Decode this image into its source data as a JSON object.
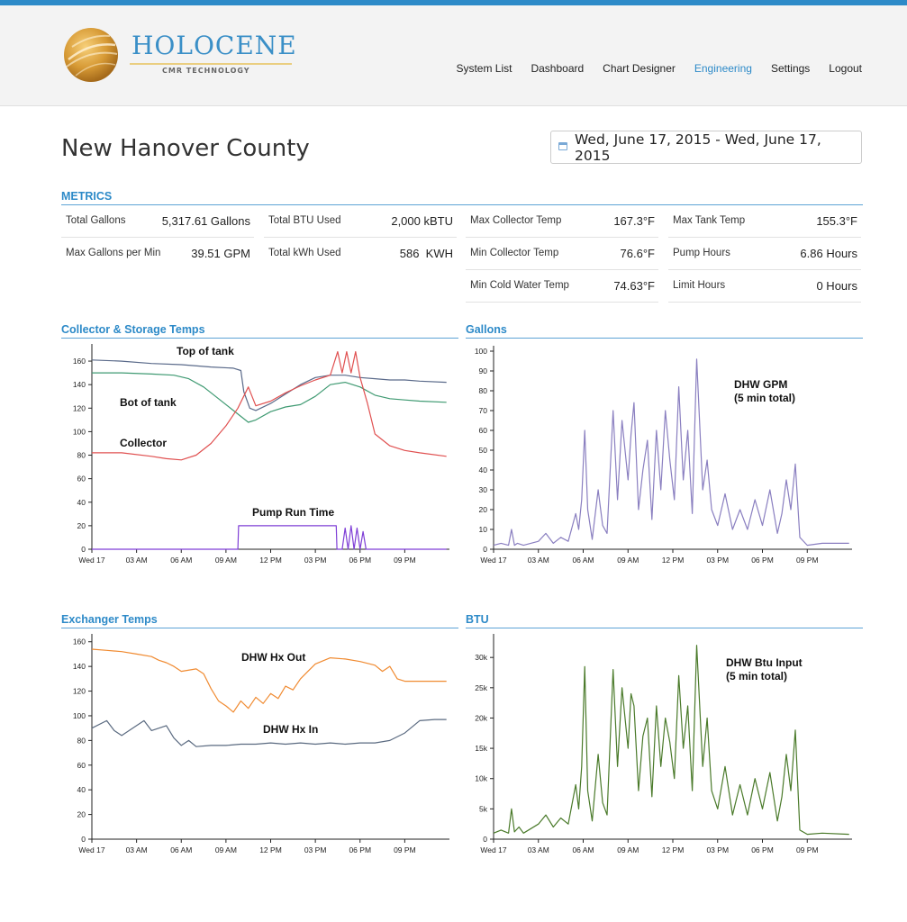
{
  "app": {
    "brand_name": "HOLOCENE",
    "brand_sub": "CMR TECHNOLOGY",
    "nav": [
      {
        "label": "System List",
        "active": false
      },
      {
        "label": "Dashboard",
        "active": false
      },
      {
        "label": "Chart Designer",
        "active": false
      },
      {
        "label": "Engineering",
        "active": true
      },
      {
        "label": "Settings",
        "active": false
      },
      {
        "label": "Logout",
        "active": false
      }
    ],
    "accent_color": "#2d8ac8"
  },
  "page": {
    "title": "New Hanover County",
    "date_range": "Wed, June 17, 2015 - Wed, June 17, 2015"
  },
  "metrics": {
    "section_title": "METRICS",
    "rows": [
      [
        {
          "label": "Total Gallons",
          "value": "5,317.61 Gallons"
        },
        {
          "label": "Total BTU Used",
          "value": "2,000 kBTU"
        },
        {
          "label": "Max Collector Temp",
          "value": "167.3°F"
        },
        {
          "label": "Max Tank Temp",
          "value": "155.3°F"
        }
      ],
      [
        {
          "label": "Max Gallons per Min",
          "value": "39.51 GPM"
        },
        {
          "label": "Total kWh Used",
          "value": "586  KWH"
        },
        {
          "label": "Min Collector Temp",
          "value": "76.6°F"
        },
        {
          "label": "Pump Hours",
          "value": "6.86 Hours"
        }
      ],
      [
        {
          "label": "Min Cold Water Temp",
          "value": "74.63°F"
        },
        {
          "label": "Limit Hours",
          "value": "0 Hours"
        }
      ]
    ]
  },
  "chart_data": [
    {
      "type": "line",
      "title": "Collector & Storage Temps",
      "x_ticks": [
        "Wed 17",
        "03 AM",
        "06 AM",
        "09 AM",
        "12 PM",
        "03 PM",
        "06 PM",
        "09 PM"
      ],
      "xlim": [
        0,
        24
      ],
      "ylim": [
        0,
        170
      ],
      "y_ticks": [
        "0",
        "20",
        "40",
        "60",
        "80",
        "100",
        "120",
        "140",
        "160"
      ],
      "annotations": [
        "Top of tank",
        "Bot of tank",
        "Collector",
        "Pump Run Time"
      ],
      "series": [
        {
          "name": "Top of tank",
          "color": "#5a6a8a",
          "x": [
            0,
            2,
            4,
            6,
            8,
            9.5,
            10,
            10.2,
            10.6,
            11,
            12,
            13,
            14,
            15,
            16,
            17,
            18,
            19,
            20,
            21,
            22,
            23.8
          ],
          "y": [
            161,
            160,
            158,
            157,
            155,
            154,
            152,
            134,
            120,
            118,
            124,
            132,
            140,
            146,
            148,
            148,
            146,
            145,
            144,
            144,
            143,
            142
          ]
        },
        {
          "name": "Bot of tank",
          "color": "#3f9a72",
          "x": [
            0,
            2,
            4,
            5.5,
            6.5,
            7.5,
            8.5,
            9.5,
            10.5,
            11,
            12,
            13,
            14,
            15,
            15.5,
            16,
            17,
            18,
            19,
            20,
            21,
            22,
            23.8
          ],
          "y": [
            150,
            150,
            149,
            148,
            145,
            138,
            128,
            118,
            108,
            110,
            117,
            121,
            123,
            130,
            135,
            140,
            142,
            138,
            131,
            128,
            127,
            126,
            125
          ]
        },
        {
          "name": "Collector",
          "color": "#e05050",
          "x": [
            0,
            2,
            4,
            5,
            6,
            7,
            8,
            9,
            9.8,
            10.5,
            11,
            12,
            13,
            14,
            15,
            16,
            16.5,
            16.8,
            17.1,
            17.4,
            17.7,
            18,
            18.5,
            19,
            20,
            21,
            22,
            23.8
          ],
          "y": [
            82,
            82,
            79,
            77,
            76,
            80,
            90,
            105,
            120,
            138,
            122,
            126,
            133,
            139,
            144,
            148,
            168,
            150,
            168,
            150,
            168,
            146,
            124,
            98,
            88,
            84,
            82,
            79
          ]
        },
        {
          "name": "Pump Run Time",
          "color": "#7f3fd6",
          "x": [
            0,
            9.8,
            9.85,
            16.4,
            16.45,
            16.8,
            17.0,
            17.2,
            17.4,
            17.6,
            17.8,
            18,
            18.2,
            18.4,
            18.6,
            23.8
          ],
          "y": [
            0,
            0,
            20,
            20,
            0,
            0,
            18,
            0,
            20,
            0,
            18,
            0,
            15,
            0,
            0,
            0
          ]
        }
      ]
    },
    {
      "type": "line",
      "title": "Gallons",
      "x_ticks": [
        "Wed 17",
        "03 AM",
        "06 AM",
        "09 AM",
        "12 PM",
        "03 PM",
        "06 PM",
        "09 PM"
      ],
      "xlim": [
        0,
        24
      ],
      "ylim": [
        0,
        100
      ],
      "y_ticks": [
        "0",
        "10",
        "20",
        "30",
        "40",
        "50",
        "60",
        "70",
        "80",
        "90",
        "100"
      ],
      "annotations": [
        "DHW GPM",
        "(5 min total)"
      ],
      "series": [
        {
          "name": "DHW GPM",
          "color": "#8a7fc0",
          "x": [
            0,
            0.5,
            1,
            1.2,
            1.4,
            1.6,
            2,
            3,
            3.5,
            4,
            4.5,
            5,
            5.5,
            5.7,
            5.9,
            6.1,
            6.3,
            6.6,
            7,
            7.3,
            7.6,
            8,
            8.3,
            8.6,
            9,
            9.2,
            9.4,
            9.7,
            10,
            10.3,
            10.6,
            10.9,
            11.2,
            11.5,
            11.8,
            12.1,
            12.4,
            12.7,
            13,
            13.3,
            13.6,
            14,
            14.3,
            14.6,
            15,
            15.5,
            16,
            16.5,
            17,
            17.5,
            18,
            18.5,
            19,
            19.3,
            19.6,
            19.9,
            20.2,
            20.5,
            21,
            22,
            23.8
          ],
          "y": [
            2,
            3,
            2,
            10,
            2,
            3,
            2,
            4,
            8,
            3,
            6,
            4,
            18,
            10,
            25,
            60,
            20,
            5,
            30,
            12,
            8,
            70,
            25,
            65,
            35,
            58,
            74,
            20,
            40,
            55,
            15,
            60,
            30,
            70,
            45,
            25,
            82,
            35,
            60,
            18,
            96,
            30,
            45,
            20,
            12,
            28,
            10,
            20,
            10,
            25,
            12,
            30,
            8,
            18,
            35,
            20,
            43,
            6,
            2,
            3,
            3
          ]
        }
      ]
    },
    {
      "type": "line",
      "title": "Exchanger Temps",
      "x_ticks": [
        "Wed 17",
        "03 AM",
        "06 AM",
        "09 AM",
        "12 PM",
        "03 PM",
        "06 PM",
        "09 PM"
      ],
      "xlim": [
        0,
        24
      ],
      "ylim": [
        0,
        162
      ],
      "y_ticks": [
        "0",
        "20",
        "40",
        "60",
        "80",
        "100",
        "120",
        "140",
        "160"
      ],
      "annotations": [
        "DHW Hx Out",
        "DHW Hx In"
      ],
      "series": [
        {
          "name": "DHW Hx Out",
          "color": "#f08a30",
          "x": [
            0,
            1,
            2,
            3,
            4,
            4.5,
            5,
            5.5,
            6,
            7,
            7.5,
            8,
            8.5,
            9,
            9.5,
            10,
            10.5,
            11,
            11.5,
            12,
            12.5,
            13,
            13.5,
            14,
            14.5,
            15,
            16,
            17,
            18,
            19,
            19.5,
            20,
            20.5,
            21,
            22,
            23.8
          ],
          "y": [
            154,
            153,
            152,
            150,
            148,
            145,
            143,
            140,
            136,
            138,
            134,
            122,
            112,
            108,
            103,
            112,
            106,
            115,
            110,
            118,
            114,
            124,
            121,
            130,
            136,
            142,
            147,
            146,
            144,
            141,
            136,
            140,
            130,
            128,
            128,
            128
          ]
        },
        {
          "name": "DHW Hx In",
          "color": "#5a6a80",
          "x": [
            0,
            1,
            1.5,
            2,
            3,
            3.5,
            4,
            5,
            5.5,
            6,
            6.5,
            7,
            8,
            9,
            10,
            11,
            12,
            13,
            14,
            15,
            16,
            17,
            18,
            19,
            20,
            21,
            22,
            23,
            23.8
          ],
          "y": [
            90,
            96,
            88,
            84,
            92,
            96,
            88,
            92,
            82,
            76,
            80,
            75,
            76,
            76,
            77,
            77,
            78,
            77,
            78,
            77,
            78,
            77,
            78,
            78,
            80,
            86,
            96,
            97,
            97
          ]
        }
      ]
    },
    {
      "type": "line",
      "title": "BTU",
      "x_ticks": [
        "Wed 17",
        "03 AM",
        "06 AM",
        "09 AM",
        "12 PM",
        "03 PM",
        "06 PM",
        "09 PM"
      ],
      "xlim": [
        0,
        24
      ],
      "ylim": [
        0,
        33000
      ],
      "y_ticks": [
        "0",
        "5k",
        "10k",
        "15k",
        "20k",
        "25k",
        "30k"
      ],
      "annotations": [
        "DHW Btu Input",
        "(5 min total)"
      ],
      "series": [
        {
          "name": "DHW Btu Input",
          "color": "#4a7a2a",
          "x": [
            0,
            0.5,
            1,
            1.2,
            1.4,
            1.7,
            2,
            3,
            3.5,
            4,
            4.5,
            5,
            5.5,
            5.7,
            5.9,
            6.1,
            6.3,
            6.6,
            7,
            7.3,
            7.6,
            8,
            8.3,
            8.6,
            9,
            9.2,
            9.4,
            9.7,
            10,
            10.3,
            10.6,
            10.9,
            11.2,
            11.5,
            11.8,
            12.1,
            12.4,
            12.7,
            13,
            13.3,
            13.6,
            14,
            14.3,
            14.6,
            15,
            15.5,
            16,
            16.5,
            17,
            17.5,
            18,
            18.5,
            19,
            19.3,
            19.6,
            19.9,
            20.2,
            20.5,
            21,
            22,
            23.8
          ],
          "y": [
            1000,
            1500,
            1000,
            5000,
            1200,
            2000,
            1000,
            2500,
            4000,
            2000,
            3500,
            2500,
            9000,
            5000,
            12000,
            28500,
            8000,
            3000,
            14000,
            6000,
            4000,
            28000,
            12000,
            25000,
            15000,
            24000,
            22000,
            8000,
            17000,
            20000,
            7000,
            22000,
            12000,
            20000,
            16000,
            10000,
            27000,
            15000,
            22000,
            8000,
            32000,
            12000,
            20000,
            8000,
            5000,
            12000,
            4000,
            9000,
            4000,
            10000,
            5000,
            11000,
            3000,
            7000,
            14000,
            8000,
            18000,
            1500,
            800,
            1000,
            800
          ]
        }
      ]
    }
  ]
}
